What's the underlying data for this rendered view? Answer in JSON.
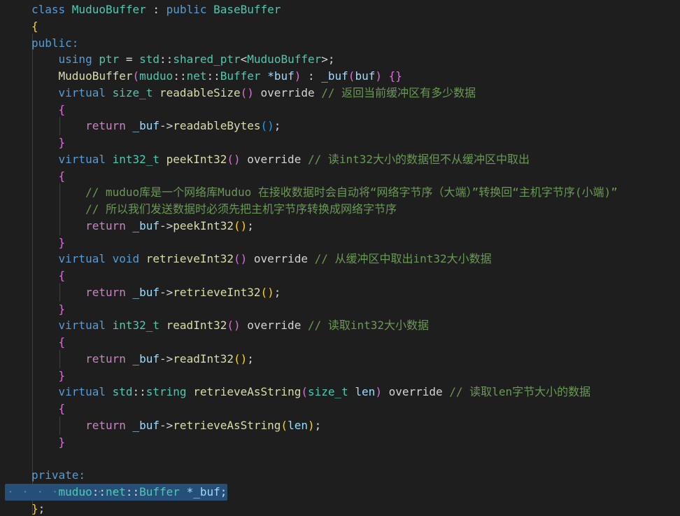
{
  "colors": {
    "background": "#1e1e1e",
    "keyword": "#569cd6",
    "control": "#c586c0",
    "type": "#4ec9b0",
    "function": "#dcdcaa",
    "variable": "#9cdcfe",
    "comment": "#6a9955",
    "bracket_gold": "#ffd700",
    "bracket_orchid": "#da70d6",
    "bracket_blue": "#179fff",
    "default": "#d4d4d4",
    "selection": "#264f78"
  },
  "code_lines": [
    [
      {
        "t": "class ",
        "c": "kw"
      },
      {
        "t": "MuduoBuffer",
        "c": "type"
      },
      {
        "t": " : ",
        "c": "def"
      },
      {
        "t": "public ",
        "c": "kw"
      },
      {
        "t": "BaseBuffer",
        "c": "type"
      }
    ],
    [
      {
        "t": "{",
        "c": "p1"
      }
    ],
    [
      {
        "t": "public:",
        "c": "kw"
      }
    ],
    [
      {
        "t": "    ",
        "c": "def"
      },
      {
        "t": "using ",
        "c": "kw"
      },
      {
        "t": "ptr",
        "c": "type"
      },
      {
        "t": " = ",
        "c": "def"
      },
      {
        "t": "std",
        "c": "type"
      },
      {
        "t": "::",
        "c": "def"
      },
      {
        "t": "shared_ptr",
        "c": "type"
      },
      {
        "t": "<",
        "c": "def"
      },
      {
        "t": "MuduoBuffer",
        "c": "type"
      },
      {
        "t": ">;",
        "c": "def"
      }
    ],
    [
      {
        "t": "    ",
        "c": "def"
      },
      {
        "t": "MuduoBuffer",
        "c": "fn"
      },
      {
        "t": "(",
        "c": "p2"
      },
      {
        "t": "muduo",
        "c": "type"
      },
      {
        "t": "::",
        "c": "def"
      },
      {
        "t": "net",
        "c": "type"
      },
      {
        "t": "::",
        "c": "def"
      },
      {
        "t": "Buffer ",
        "c": "type"
      },
      {
        "t": "*buf",
        "c": "var"
      },
      {
        "t": ")",
        "c": "p2"
      },
      {
        "t": " : ",
        "c": "def"
      },
      {
        "t": "_buf",
        "c": "var"
      },
      {
        "t": "(",
        "c": "p2"
      },
      {
        "t": "buf",
        "c": "var"
      },
      {
        "t": ")",
        "c": "p2"
      },
      {
        "t": " ",
        "c": "def"
      },
      {
        "t": "{}",
        "c": "p2"
      }
    ],
    [
      {
        "t": "    ",
        "c": "def"
      },
      {
        "t": "virtual ",
        "c": "kw"
      },
      {
        "t": "size_t ",
        "c": "type"
      },
      {
        "t": "readableSize",
        "c": "fn"
      },
      {
        "t": "()",
        "c": "p2"
      },
      {
        "t": " override ",
        "c": "def"
      },
      {
        "t": "// 返回当前缓冲区有多少数据",
        "c": "com"
      }
    ],
    [
      {
        "t": "    ",
        "c": "def"
      },
      {
        "t": "{",
        "c": "p2"
      }
    ],
    [
      {
        "t": "        ",
        "c": "def"
      },
      {
        "t": "return ",
        "c": "ctrl"
      },
      {
        "t": "_buf",
        "c": "var"
      },
      {
        "t": "->",
        "c": "def"
      },
      {
        "t": "readableBytes",
        "c": "fn"
      },
      {
        "t": "()",
        "c": "p3"
      },
      {
        "t": ";",
        "c": "def"
      }
    ],
    [
      {
        "t": "    ",
        "c": "def"
      },
      {
        "t": "}",
        "c": "p2"
      }
    ],
    [
      {
        "t": "    ",
        "c": "def"
      },
      {
        "t": "virtual ",
        "c": "kw"
      },
      {
        "t": "int32_t ",
        "c": "type"
      },
      {
        "t": "peekInt32",
        "c": "fn"
      },
      {
        "t": "()",
        "c": "p2"
      },
      {
        "t": " override ",
        "c": "def"
      },
      {
        "t": "// 读int32大小的数据但不从缓冲区中取出",
        "c": "com"
      }
    ],
    [
      {
        "t": "    ",
        "c": "def"
      },
      {
        "t": "{",
        "c": "p2"
      }
    ],
    [
      {
        "t": "        ",
        "c": "def"
      },
      {
        "t": "// muduo库是一个网络库Muduo 在接收数据时会自动将“网络字节序（大端）”转换回“主机字节序(小端)”",
        "c": "com"
      }
    ],
    [
      {
        "t": "        ",
        "c": "def"
      },
      {
        "t": "// 所以我们发送数据时必须先把主机字节序转换成网络字节序",
        "c": "com"
      }
    ],
    [
      {
        "t": "        ",
        "c": "def"
      },
      {
        "t": "return ",
        "c": "ctrl"
      },
      {
        "t": "_buf",
        "c": "var"
      },
      {
        "t": "->",
        "c": "def"
      },
      {
        "t": "peekInt32",
        "c": "fn"
      },
      {
        "t": "()",
        "c": "p1"
      },
      {
        "t": ";",
        "c": "def"
      }
    ],
    [
      {
        "t": "    ",
        "c": "def"
      },
      {
        "t": "}",
        "c": "p2"
      }
    ],
    [
      {
        "t": "    ",
        "c": "def"
      },
      {
        "t": "virtual ",
        "c": "kw"
      },
      {
        "t": "void ",
        "c": "kw"
      },
      {
        "t": "retrieveInt32",
        "c": "fn"
      },
      {
        "t": "()",
        "c": "p2"
      },
      {
        "t": " override ",
        "c": "def"
      },
      {
        "t": "// 从缓冲区中取出int32大小数据",
        "c": "com"
      }
    ],
    [
      {
        "t": "    ",
        "c": "def"
      },
      {
        "t": "{",
        "c": "p2"
      }
    ],
    [
      {
        "t": "        ",
        "c": "def"
      },
      {
        "t": "return ",
        "c": "ctrl"
      },
      {
        "t": "_buf",
        "c": "var"
      },
      {
        "t": "->",
        "c": "def"
      },
      {
        "t": "retrieveInt32",
        "c": "fn"
      },
      {
        "t": "()",
        "c": "p1"
      },
      {
        "t": ";",
        "c": "def"
      }
    ],
    [
      {
        "t": "    ",
        "c": "def"
      },
      {
        "t": "}",
        "c": "p2"
      }
    ],
    [
      {
        "t": "    ",
        "c": "def"
      },
      {
        "t": "virtual ",
        "c": "kw"
      },
      {
        "t": "int32_t ",
        "c": "type"
      },
      {
        "t": "readInt32",
        "c": "fn"
      },
      {
        "t": "()",
        "c": "p2"
      },
      {
        "t": " override ",
        "c": "def"
      },
      {
        "t": "// 读取int32大小数据",
        "c": "com"
      }
    ],
    [
      {
        "t": "    ",
        "c": "def"
      },
      {
        "t": "{",
        "c": "p2"
      }
    ],
    [
      {
        "t": "        ",
        "c": "def"
      },
      {
        "t": "return ",
        "c": "ctrl"
      },
      {
        "t": "_buf",
        "c": "var"
      },
      {
        "t": "->",
        "c": "def"
      },
      {
        "t": "readInt32",
        "c": "fn"
      },
      {
        "t": "()",
        "c": "p1"
      },
      {
        "t": ";",
        "c": "def"
      }
    ],
    [
      {
        "t": "    ",
        "c": "def"
      },
      {
        "t": "}",
        "c": "p2"
      }
    ],
    [
      {
        "t": "    ",
        "c": "def"
      },
      {
        "t": "virtual ",
        "c": "kw"
      },
      {
        "t": "std",
        "c": "type"
      },
      {
        "t": "::",
        "c": "def"
      },
      {
        "t": "string ",
        "c": "type"
      },
      {
        "t": "retrieveAsString",
        "c": "fn"
      },
      {
        "t": "(",
        "c": "p2"
      },
      {
        "t": "size_t ",
        "c": "type"
      },
      {
        "t": "len",
        "c": "var"
      },
      {
        "t": ")",
        "c": "p2"
      },
      {
        "t": " override ",
        "c": "def"
      },
      {
        "t": "// 读取len字节大小的数据",
        "c": "com"
      }
    ],
    [
      {
        "t": "    ",
        "c": "def"
      },
      {
        "t": "{",
        "c": "p2"
      }
    ],
    [
      {
        "t": "        ",
        "c": "def"
      },
      {
        "t": "return ",
        "c": "ctrl"
      },
      {
        "t": "_buf",
        "c": "var"
      },
      {
        "t": "->",
        "c": "def"
      },
      {
        "t": "retrieveAsString",
        "c": "fn"
      },
      {
        "t": "(",
        "c": "p1"
      },
      {
        "t": "len",
        "c": "var"
      },
      {
        "t": ")",
        "c": "p1"
      },
      {
        "t": ";",
        "c": "def"
      }
    ],
    [
      {
        "t": "    ",
        "c": "def"
      },
      {
        "t": "}",
        "c": "p2"
      }
    ],
    [],
    [
      {
        "t": "private:",
        "c": "kw"
      }
    ],
    [
      {
        "t": "    ",
        "c": "def"
      },
      {
        "t": "muduo",
        "c": "type"
      },
      {
        "t": "::",
        "c": "def"
      },
      {
        "t": "net",
        "c": "type"
      },
      {
        "t": "::",
        "c": "def"
      },
      {
        "t": "Buffer ",
        "c": "type"
      },
      {
        "t": "*_buf",
        "c": "var"
      },
      {
        "t": ";",
        "c": "def"
      }
    ],
    [
      {
        "t": "}",
        "c": "p1"
      },
      {
        "t": ";",
        "c": "def"
      }
    ]
  ]
}
